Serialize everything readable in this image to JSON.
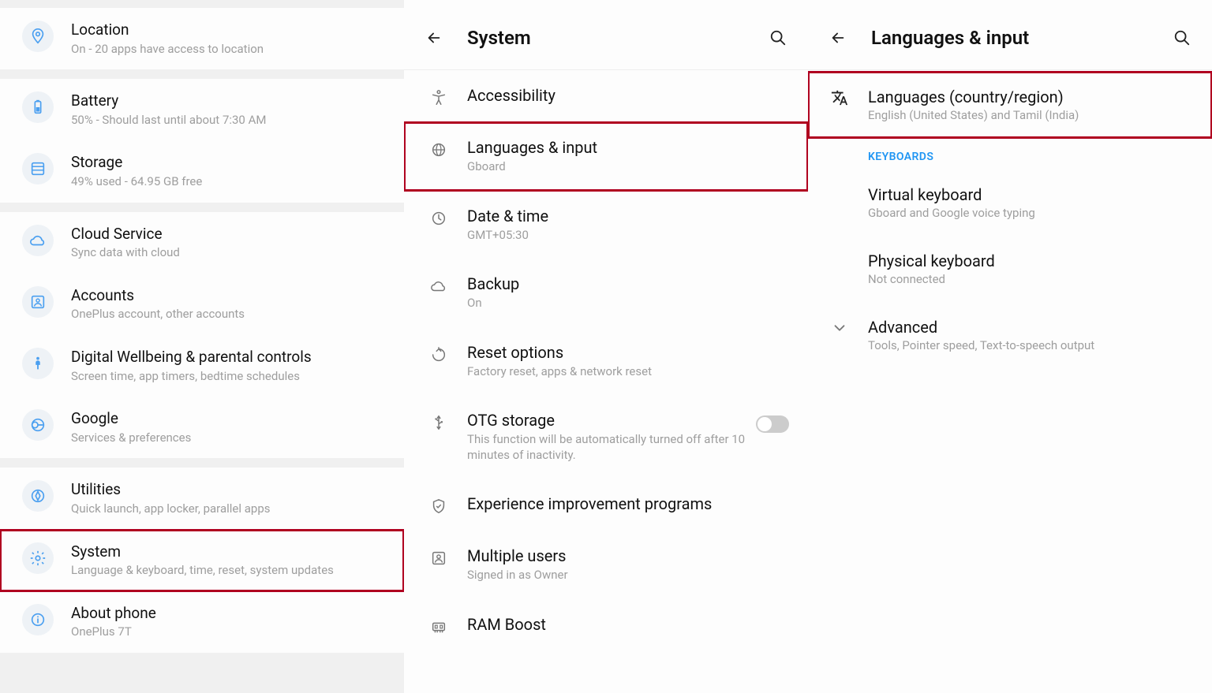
{
  "panel1": {
    "items": [
      {
        "title": "Location",
        "sub": "On - 20 apps have access to location",
        "icon": "location",
        "highlight": false
      },
      {
        "title": "Battery",
        "sub": "50% - Should last until about 7:30 AM",
        "icon": "battery",
        "highlight": false
      },
      {
        "title": "Storage",
        "sub": "49% used - 64.95 GB free",
        "icon": "storage",
        "highlight": false
      },
      {
        "title": "Cloud Service",
        "sub": "Sync data with cloud",
        "icon": "cloud",
        "highlight": false
      },
      {
        "title": "Accounts",
        "sub": "OnePlus account, other accounts",
        "icon": "accounts",
        "highlight": false
      },
      {
        "title": "Digital Wellbeing & parental controls",
        "sub": "Screen time, app timers, bedtime schedules",
        "icon": "wellbeing",
        "highlight": false
      },
      {
        "title": "Google",
        "sub": "Services & preferences",
        "icon": "google",
        "highlight": false
      },
      {
        "title": "Utilities",
        "sub": "Quick launch, app locker, parallel apps",
        "icon": "utilities",
        "highlight": false
      },
      {
        "title": "System",
        "sub": "Language & keyboard, time, reset, system updates",
        "icon": "system",
        "highlight": true
      },
      {
        "title": "About phone",
        "sub": "OnePlus 7T",
        "icon": "about",
        "highlight": false
      }
    ],
    "dividers_after": [
      0,
      2,
      6
    ]
  },
  "panel2": {
    "header": "System",
    "items": [
      {
        "title": "Accessibility",
        "sub": "",
        "icon": "accessibility",
        "highlight": false
      },
      {
        "title": "Languages & input",
        "sub": "Gboard",
        "icon": "globe",
        "highlight": true
      },
      {
        "title": "Date & time",
        "sub": "GMT+05:30",
        "icon": "clock",
        "highlight": false
      },
      {
        "title": "Backup",
        "sub": "On",
        "icon": "cloud-outline",
        "highlight": false
      },
      {
        "title": "Reset options",
        "sub": "Factory reset, apps & network reset",
        "icon": "reset",
        "highlight": false
      },
      {
        "title": "OTG storage",
        "sub": "This function will be automatically turned off after 10 minutes of inactivity.",
        "icon": "usb",
        "highlight": false,
        "toggle": true
      },
      {
        "title": "Experience improvement programs",
        "sub": "",
        "icon": "shield-check",
        "highlight": false
      },
      {
        "title": "Multiple users",
        "sub": "Signed in as Owner",
        "icon": "user-box",
        "highlight": false
      },
      {
        "title": "RAM Boost",
        "sub": "",
        "icon": "ram",
        "highlight": false
      }
    ]
  },
  "panel3": {
    "header": "Languages & input",
    "top_item": {
      "title": "Languages (country/region)",
      "sub": "English (United States) and Tamil (India)",
      "icon": "translate",
      "highlight": true
    },
    "section_header": "KEYBOARDS",
    "items": [
      {
        "title": "Virtual keyboard",
        "sub": "Gboard and Google voice typing"
      },
      {
        "title": "Physical keyboard",
        "sub": "Not connected"
      }
    ],
    "advanced": {
      "title": "Advanced",
      "sub": "Tools, Pointer speed, Text-to-speech output"
    }
  }
}
